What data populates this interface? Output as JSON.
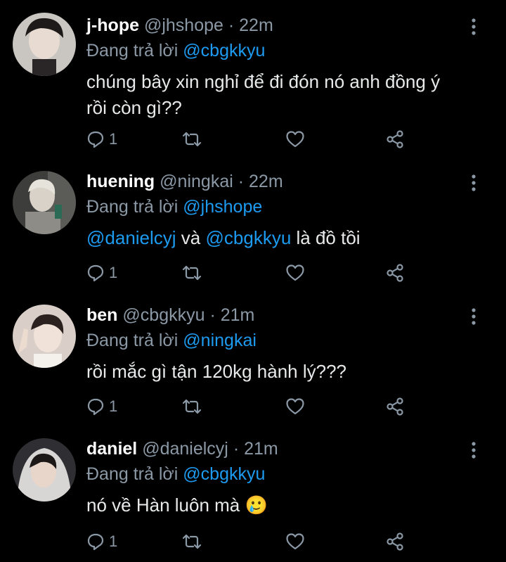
{
  "tweets": [
    {
      "display_name": "j-hope",
      "handle": "@jhshope",
      "separator": "·",
      "time": "22m",
      "reply_prefix": "Đang trả lời",
      "reply_to": "@cbgkkyu",
      "text_line1": "chúng bây xin nghỉ để đi đón nó anh đồng ý",
      "text_line2": "rồi còn gì??",
      "reply_count": "1"
    },
    {
      "display_name": "huening",
      "handle": "@ningkai",
      "separator": "·",
      "time": "22m",
      "reply_prefix": "Đang trả lời",
      "reply_to": "@jhshope",
      "mention1": "@danielcyj",
      "conj": "và",
      "mention2": "@cbgkkyu",
      "text_tail": "là đồ tồi",
      "reply_count": "1"
    },
    {
      "display_name": "ben",
      "handle": "@cbgkkyu",
      "separator": "·",
      "time": "21m",
      "reply_prefix": "Đang trả lời",
      "reply_to": "@ningkai",
      "text_line1": "rồi mắc gì tận 120kg hành lý???",
      "reply_count": "1"
    },
    {
      "display_name": "daniel",
      "handle": "@danielcyj",
      "separator": "·",
      "time": "21m",
      "reply_prefix": "Đang trả lời",
      "reply_to": "@cbgkkyu",
      "text_line1": "nó về Hàn luôn mà",
      "emoji": "🥲",
      "reply_count": "1"
    }
  ],
  "colors": {
    "background": "#000000",
    "text": "#e7e9ea",
    "muted": "#8b98a5",
    "mention": "#1d9bf0"
  },
  "icons": [
    "reply-icon",
    "retweet-icon",
    "like-icon",
    "share-icon",
    "more-options-icon"
  ]
}
